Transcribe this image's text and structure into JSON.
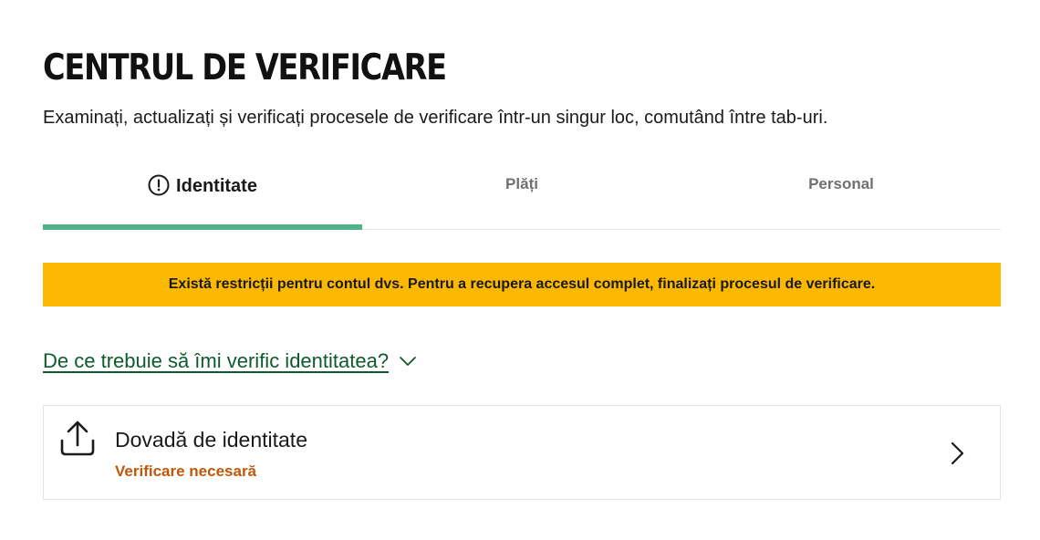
{
  "header": {
    "title": "CENTRUL DE VERIFICARE",
    "subtitle": "Examinați, actualizați și verificați procesele de verificare într-un singur loc, comutând între tab-uri."
  },
  "tabs": [
    {
      "label": "Identitate",
      "active": true,
      "icon": "exclamation-circle-icon"
    },
    {
      "label": "Plăți",
      "active": false
    },
    {
      "label": "Personal",
      "active": false
    }
  ],
  "alert": {
    "text": "Există restricții pentru contul dvs. Pentru a recupera accesul complet, finalizați procesul de verificare.",
    "color": "#fbb800"
  },
  "faq": {
    "label": "De ce trebuie să îmi verific identitatea?",
    "icon": "chevron-down-icon",
    "color": "#0e5a2d"
  },
  "card": {
    "icon": "upload-icon",
    "title": "Dovadă de identitate",
    "status": "Verificare necesară",
    "status_color": "#c0580a",
    "action_icon": "chevron-right-icon"
  },
  "colors": {
    "accent": "#4fb38a",
    "warning": "#fbb800",
    "link": "#0e5a2d"
  }
}
